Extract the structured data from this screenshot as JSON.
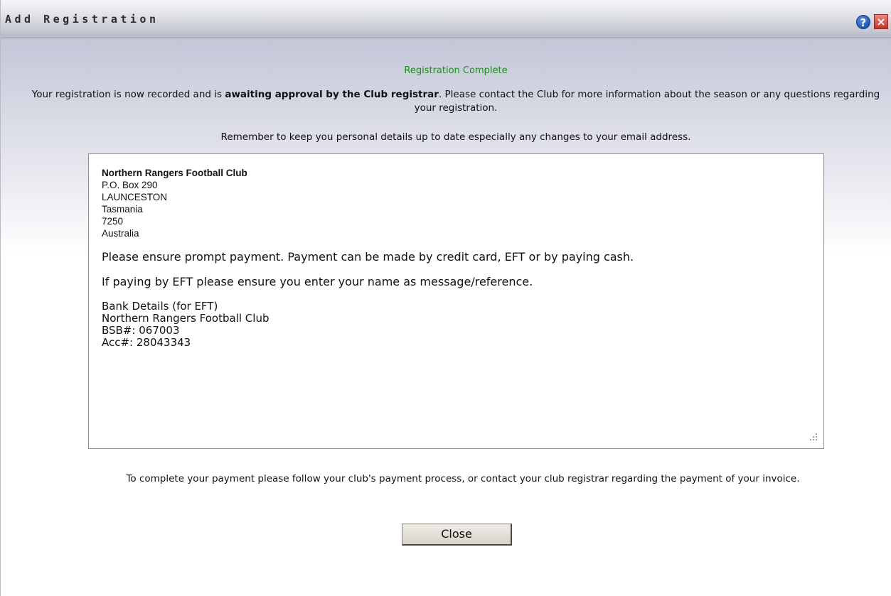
{
  "window": {
    "title": "Add Registration",
    "help_icon": "?",
    "close_icon": "×"
  },
  "status": {
    "text": "Registration Complete",
    "color": "#1f8a1f"
  },
  "intro": {
    "part1": "Your registration is now recorded and is ",
    "bold": "awaiting approval by the Club registrar",
    "part2": ". Please contact the Club for more information about the season or any questions regarding your registration."
  },
  "reminder": "Remember to keep you personal details up to date especially any changes to your email address.",
  "club": {
    "name": "Northern Rangers Football Club",
    "address": [
      "P.O. Box 290",
      "LAUNCESTON",
      "Tasmania",
      "7250",
      "Australia"
    ],
    "payment_note": "Please ensure prompt payment. Payment can be made by credit card, EFT or by paying cash.",
    "eft_note": "If paying by EFT please ensure you enter your name as message/reference.",
    "bank_lines": [
      "Bank Details (for EFT)",
      "Northern Rangers Football Club",
      "BSB#: 067003",
      "Acc#: 28043343"
    ]
  },
  "footer": "To complete your payment please follow your club's payment process, or contact your club registrar regarding the payment of your invoice.",
  "buttons": {
    "close_label": "Close"
  }
}
